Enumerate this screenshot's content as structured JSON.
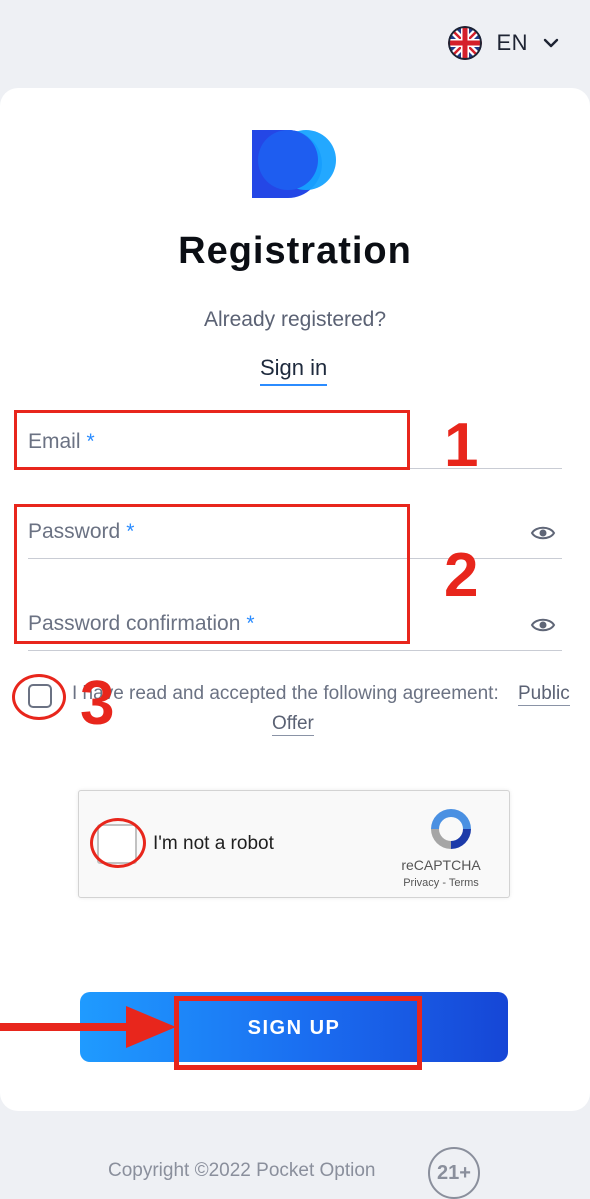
{
  "header": {
    "language_code": "EN",
    "flag_icon": "uk-flag-icon"
  },
  "brand": {
    "logo": "pocket-option-logo",
    "colors": {
      "primary": "#2b5cff",
      "accent": "#1aa0ff"
    }
  },
  "form": {
    "title": "Registration",
    "already_registered": "Already registered?",
    "sign_in_link": "Sign in",
    "email": {
      "label": "Email",
      "required_mark": "*",
      "value": ""
    },
    "password": {
      "label": "Password",
      "required_mark": "*",
      "value": ""
    },
    "password_confirmation": {
      "label": "Password confirmation",
      "required_mark": "*",
      "value": ""
    },
    "agreement": {
      "text": "I have read and accepted the following agreement:",
      "link_part1": "Public",
      "link_part2": "Offer",
      "checked": false
    },
    "recaptcha": {
      "label": "I'm not a robot",
      "brand": "reCAPTCHA",
      "links": "Privacy - Terms"
    },
    "submit_label": "SIGN UP"
  },
  "annotations": {
    "step1": "1",
    "step2": "2",
    "step3": "3",
    "color": "#e8261c"
  },
  "footer": {
    "copyright": "Copyright ©2022 Pocket Option",
    "age_badge": "21+"
  }
}
